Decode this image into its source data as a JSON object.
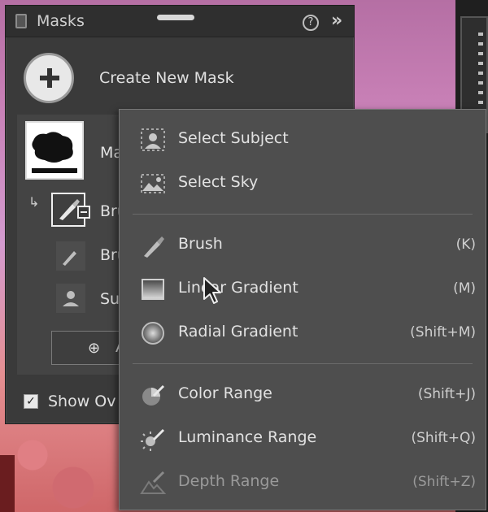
{
  "panel": {
    "title": "Masks",
    "help_icon_glyph": "?",
    "expand_icon_glyph": "»",
    "create_label": "Create New Mask",
    "mask_name": "Ma",
    "rows": [
      {
        "label": "Bru"
      },
      {
        "label": "Bru"
      },
      {
        "label": "Sul"
      }
    ],
    "add_button_label": "A",
    "show_overlay_label": "Show Ov",
    "show_overlay_checked": true
  },
  "menu": {
    "sections": [
      {
        "items": [
          {
            "label": "Select Subject",
            "shortcut": "",
            "icon": "select-subject-icon",
            "disabled": false
          },
          {
            "label": "Select Sky",
            "shortcut": "",
            "icon": "select-sky-icon",
            "disabled": false
          }
        ]
      },
      {
        "items": [
          {
            "label": "Brush",
            "shortcut": "(K)",
            "icon": "brush-icon",
            "disabled": false
          },
          {
            "label": "Linear Gradient",
            "shortcut": "(M)",
            "icon": "linear-gradient-icon",
            "disabled": false
          },
          {
            "label": "Radial Gradient",
            "shortcut": "(Shift+M)",
            "icon": "radial-gradient-icon",
            "disabled": false
          }
        ]
      },
      {
        "items": [
          {
            "label": "Color Range",
            "shortcut": "(Shift+J)",
            "icon": "color-range-icon",
            "disabled": false
          },
          {
            "label": "Luminance Range",
            "shortcut": "(Shift+Q)",
            "icon": "luminance-range-icon",
            "disabled": false
          },
          {
            "label": "Depth Range",
            "shortcut": "(Shift+Z)",
            "icon": "depth-range-icon",
            "disabled": true
          }
        ]
      }
    ]
  },
  "colors": {
    "panel_bg": "#3a3a3a",
    "menu_bg": "#4e4e4e",
    "text": "#e2e2e2",
    "disabled_text": "#9a9a9a"
  }
}
